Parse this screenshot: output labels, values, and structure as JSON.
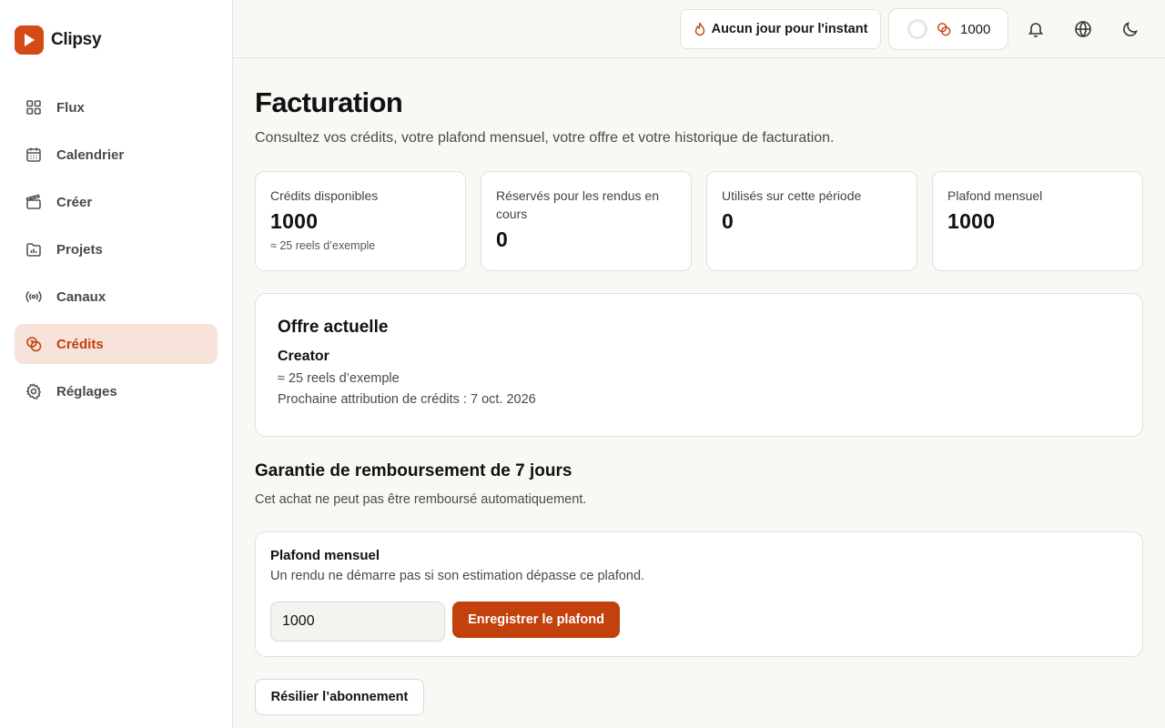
{
  "app": {
    "name": "Clipsy",
    "accent": "#c2410c"
  },
  "sidebar": {
    "items": [
      {
        "label": "Flux",
        "icon": "grid-icon"
      },
      {
        "label": "Calendrier",
        "icon": "calendar-icon"
      },
      {
        "label": "Créer",
        "icon": "clapperboard-icon"
      },
      {
        "label": "Projets",
        "icon": "folder-chart-icon"
      },
      {
        "label": "Canaux",
        "icon": "broadcast-icon"
      },
      {
        "label": "Crédits",
        "icon": "coins-icon",
        "active": true
      },
      {
        "label": "Réglages",
        "icon": "gear-icon"
      }
    ]
  },
  "header": {
    "streak_label": "Aucun jour pour l'instant",
    "credits_value": "1000",
    "icons": [
      "bell-icon",
      "globe-icon",
      "moon-icon"
    ]
  },
  "page": {
    "title": "Facturation",
    "subtitle": "Consultez vos crédits, votre plafond mensuel, votre offre et votre historique de facturation."
  },
  "stats": [
    {
      "label": "Crédits disponibles",
      "value": "1000",
      "hint": "≈ 25 reels d’exemple"
    },
    {
      "label": "Réservés pour les rendus en cours",
      "value": "0"
    },
    {
      "label": "Utilisés sur cette période",
      "value": "0"
    },
    {
      "label": "Plafond mensuel",
      "value": "1000"
    }
  ],
  "offer": {
    "title": "Offre actuelle",
    "plan": "Creator",
    "estimate": "≈ 25 reels d’exemple",
    "next_credits": "Prochaine attribution de crédits : 7 oct. 2026"
  },
  "guarantee": {
    "title": "Garantie de remboursement de 7 jours",
    "text": "Cet achat ne peut pas être remboursé automatiquement."
  },
  "cap": {
    "title": "Plafond mensuel",
    "description": "Un rendu ne démarre pas si son estimation dépasse ce plafond.",
    "input_value": "1000",
    "save_label": "Enregistrer le plafond"
  },
  "cancel_label": "Résilier l’abonnement"
}
